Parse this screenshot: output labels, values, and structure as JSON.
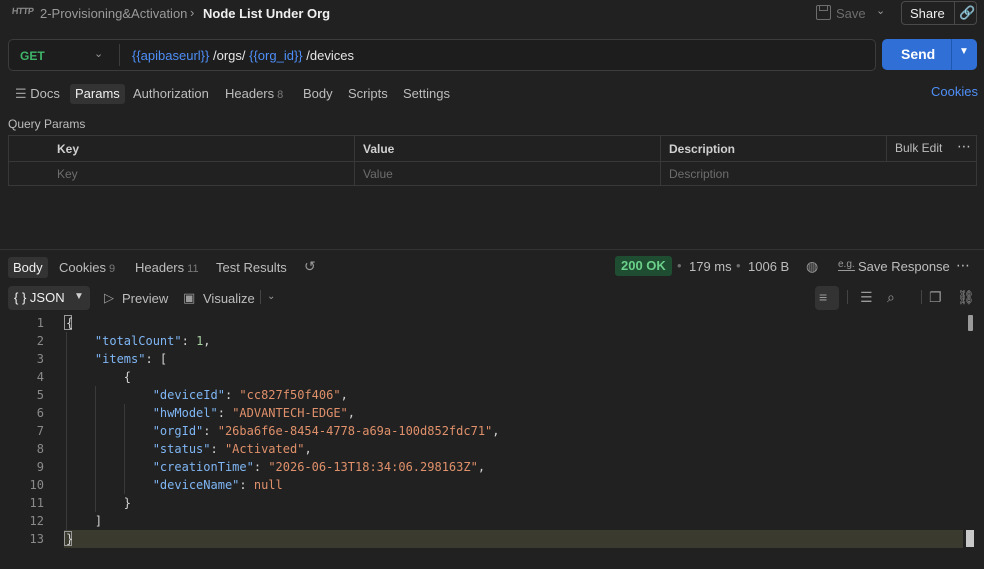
{
  "header": {
    "breadcrumb": "2-Provisioning&Activation",
    "title": "Node List Under Org",
    "save_label": "Save",
    "share_label": "Share",
    "http_icon_text": "HTTP"
  },
  "request": {
    "method": "GET",
    "url_parts": [
      "{{apibaseurl}}",
      "/orgs/",
      "{{org_id}}",
      "/devices"
    ],
    "send_label": "Send"
  },
  "request_tabs": [
    {
      "label": "Docs"
    },
    {
      "label": "Params",
      "active": true
    },
    {
      "label": "Authorization"
    },
    {
      "label": "Headers",
      "badge": "8"
    },
    {
      "label": "Body"
    },
    {
      "label": "Scripts"
    },
    {
      "label": "Settings"
    }
  ],
  "cookies_link": "Cookies",
  "query_params": {
    "title": "Query Params",
    "headers": [
      "Key",
      "Value",
      "Description"
    ],
    "placeholders": [
      "Key",
      "Value",
      "Description"
    ],
    "bulk_edit": "Bulk Edit"
  },
  "response_tabs": [
    {
      "label": "Body",
      "active": true
    },
    {
      "label": "Cookies",
      "badge": "9"
    },
    {
      "label": "Headers",
      "badge": "11"
    },
    {
      "label": "Test Results"
    }
  ],
  "response_meta": {
    "status": "200 OK",
    "time": "179 ms",
    "size": "1006 B",
    "save_response": "Save Response",
    "eg_icon_text": "e.g."
  },
  "format_bar": {
    "format": "{ } JSON",
    "preview": "Preview",
    "visualize": "Visualize"
  },
  "code_lines": [
    {
      "n": "1",
      "tokens": [
        [
          "p",
          "{"
        ]
      ]
    },
    {
      "n": "2",
      "tokens": [
        [
          "p",
          "    "
        ],
        [
          "k",
          "\"totalCount\""
        ],
        [
          "p",
          ": "
        ],
        [
          "n",
          "1"
        ],
        [
          "p",
          ","
        ]
      ]
    },
    {
      "n": "3",
      "tokens": [
        [
          "p",
          "    "
        ],
        [
          "k",
          "\"items\""
        ],
        [
          "p",
          ": ["
        ]
      ]
    },
    {
      "n": "4",
      "tokens": [
        [
          "p",
          "        {"
        ]
      ]
    },
    {
      "n": "5",
      "tokens": [
        [
          "p",
          "            "
        ],
        [
          "k",
          "\"deviceId\""
        ],
        [
          "p",
          ": "
        ],
        [
          "s",
          "\"cc827f50f406\""
        ],
        [
          "p",
          ","
        ]
      ]
    },
    {
      "n": "6",
      "tokens": [
        [
          "p",
          "            "
        ],
        [
          "k",
          "\"hwModel\""
        ],
        [
          "p",
          ": "
        ],
        [
          "s",
          "\"ADVANTECH-EDGE\""
        ],
        [
          "p",
          ","
        ]
      ]
    },
    {
      "n": "7",
      "tokens": [
        [
          "p",
          "            "
        ],
        [
          "k",
          "\"orgId\""
        ],
        [
          "p",
          ": "
        ],
        [
          "s",
          "\"26ba6f6e-8454-4778-a69a-100d852fdc71\""
        ],
        [
          "p",
          ","
        ]
      ]
    },
    {
      "n": "8",
      "tokens": [
        [
          "p",
          "            "
        ],
        [
          "k",
          "\"status\""
        ],
        [
          "p",
          ": "
        ],
        [
          "s",
          "\"Activated\""
        ],
        [
          "p",
          ","
        ]
      ]
    },
    {
      "n": "9",
      "tokens": [
        [
          "p",
          "            "
        ],
        [
          "k",
          "\"creationTime\""
        ],
        [
          "p",
          ": "
        ],
        [
          "s",
          "\"2026-06-13T18:34:06.298163Z\""
        ],
        [
          "p",
          ","
        ]
      ]
    },
    {
      "n": "10",
      "tokens": [
        [
          "p",
          "            "
        ],
        [
          "k",
          "\"deviceName\""
        ],
        [
          "p",
          ": "
        ],
        [
          "w",
          "null"
        ]
      ]
    },
    {
      "n": "11",
      "tokens": [
        [
          "p",
          "        }"
        ]
      ]
    },
    {
      "n": "12",
      "tokens": [
        [
          "p",
          "    ]"
        ]
      ]
    },
    {
      "n": "13",
      "tokens": [
        [
          "p",
          "}"
        ]
      ]
    }
  ],
  "colors": {
    "accent": "#2f6fd6",
    "status_ok": "#6bd089",
    "method_get": "#3fb56a",
    "variable": "#4e8ff7"
  }
}
